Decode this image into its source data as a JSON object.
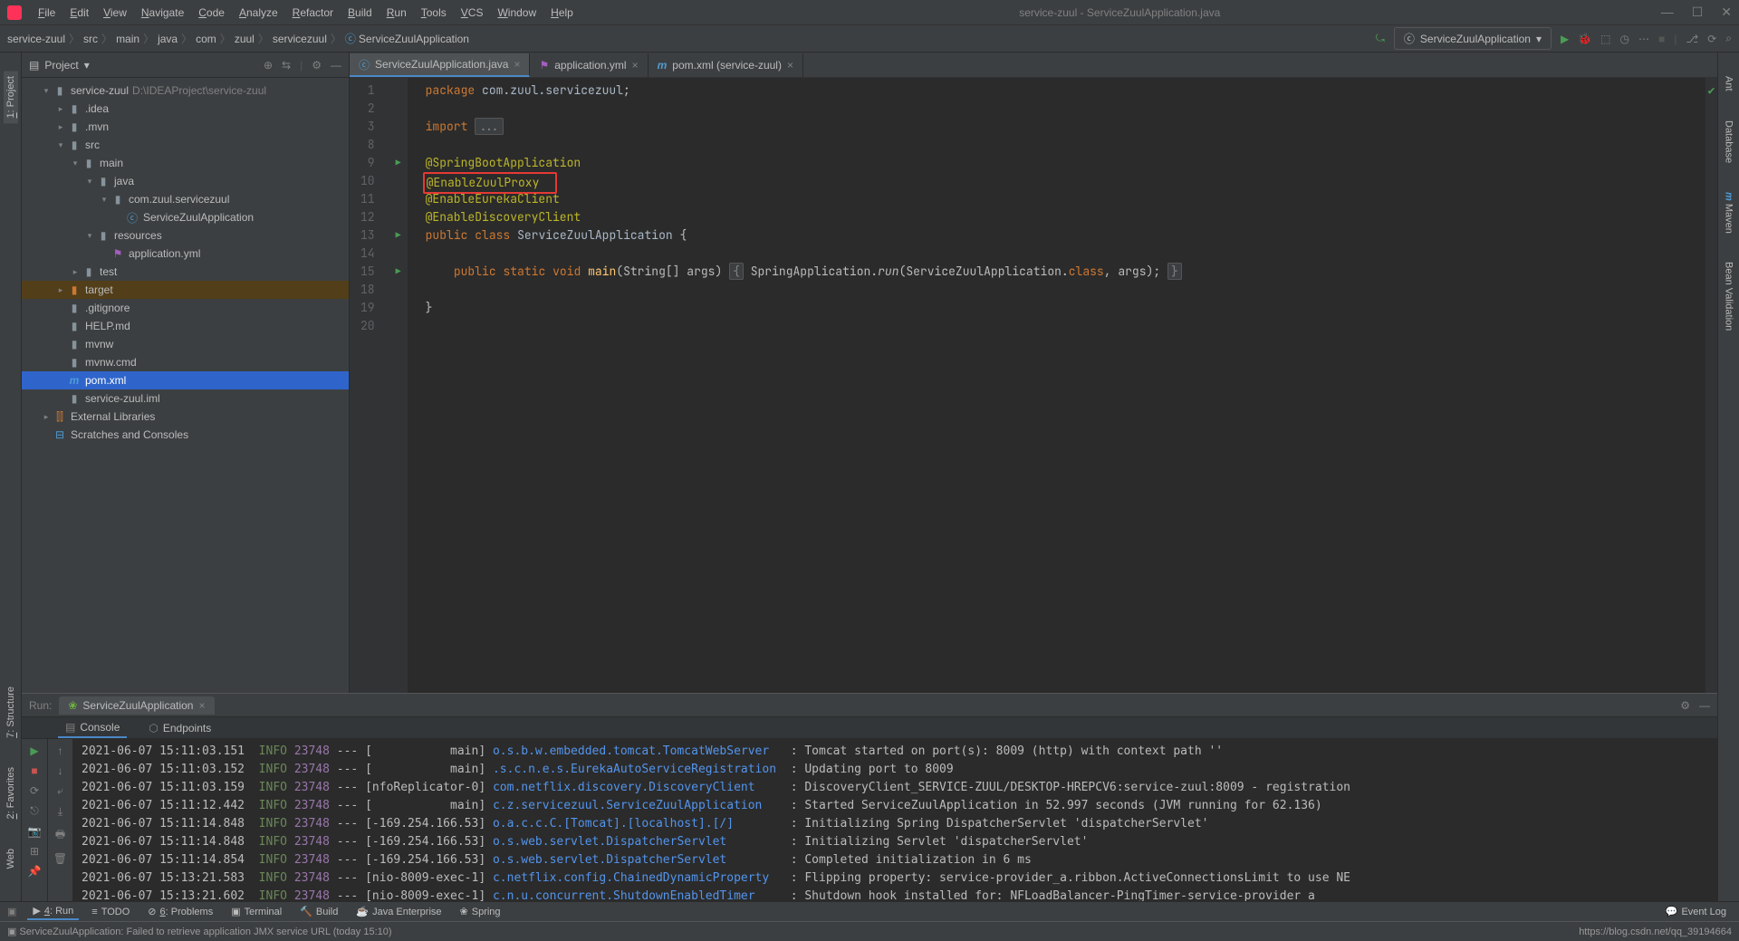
{
  "window": {
    "title": "service-zuul - ServiceZuulApplication.java"
  },
  "menu": [
    "File",
    "Edit",
    "View",
    "Navigate",
    "Code",
    "Analyze",
    "Refactor",
    "Build",
    "Run",
    "Tools",
    "VCS",
    "Window",
    "Help"
  ],
  "breadcrumb": [
    "service-zuul",
    "src",
    "main",
    "java",
    "com",
    "zuul",
    "servicezuul",
    "ServiceZuulApplication"
  ],
  "run_config": "ServiceZuulApplication",
  "project_panel": {
    "title": "Project",
    "root": {
      "name": "service-zuul",
      "path": "D:\\IDEAProject\\service-zuul"
    },
    "tree": [
      {
        "depth": 1,
        "arrow": "▾",
        "icon": "folder",
        "label": "service-zuul",
        "path": "D:\\IDEAProject\\service-zuul"
      },
      {
        "depth": 2,
        "arrow": "▸",
        "icon": "folder",
        "label": ".idea"
      },
      {
        "depth": 2,
        "arrow": "▸",
        "icon": "folder",
        "label": ".mvn"
      },
      {
        "depth": 2,
        "arrow": "▾",
        "icon": "folder",
        "label": "src"
      },
      {
        "depth": 3,
        "arrow": "▾",
        "icon": "folder",
        "label": "main"
      },
      {
        "depth": 4,
        "arrow": "▾",
        "icon": "folder-src",
        "label": "java"
      },
      {
        "depth": 5,
        "arrow": "▾",
        "icon": "package",
        "label": "com.zuul.servicezuul"
      },
      {
        "depth": 6,
        "arrow": "",
        "icon": "class",
        "label": "ServiceZuulApplication"
      },
      {
        "depth": 4,
        "arrow": "▾",
        "icon": "folder-res",
        "label": "resources"
      },
      {
        "depth": 5,
        "arrow": "",
        "icon": "yml",
        "label": "application.yml"
      },
      {
        "depth": 3,
        "arrow": "▸",
        "icon": "folder",
        "label": "test"
      },
      {
        "depth": 2,
        "arrow": "▸",
        "icon": "folder-ex",
        "label": "target",
        "hl": true
      },
      {
        "depth": 2,
        "arrow": "",
        "icon": "file",
        "label": ".gitignore"
      },
      {
        "depth": 2,
        "arrow": "",
        "icon": "file",
        "label": "HELP.md"
      },
      {
        "depth": 2,
        "arrow": "",
        "icon": "file",
        "label": "mvnw"
      },
      {
        "depth": 2,
        "arrow": "",
        "icon": "file",
        "label": "mvnw.cmd"
      },
      {
        "depth": 2,
        "arrow": "",
        "icon": "maven",
        "label": "pom.xml",
        "selected": true
      },
      {
        "depth": 2,
        "arrow": "",
        "icon": "file",
        "label": "service-zuul.iml"
      },
      {
        "depth": 1,
        "arrow": "▸",
        "icon": "lib",
        "label": "External Libraries"
      },
      {
        "depth": 1,
        "arrow": "",
        "icon": "scratch",
        "label": "Scratches and Consoles"
      }
    ]
  },
  "editor_tabs": [
    {
      "icon": "class",
      "label": "ServiceZuulApplication.java",
      "active": true
    },
    {
      "icon": "yml",
      "label": "application.yml"
    },
    {
      "icon": "maven",
      "label": "pom.xml (service-zuul)"
    }
  ],
  "code": {
    "lines": [
      {
        "n": 1,
        "html": "<span class='kw'>package</span> <span class='pkg'>com.zuul.servicezuul</span>;"
      },
      {
        "n": 2,
        "html": ""
      },
      {
        "n": 3,
        "html": "<span class='kw'>import</span> <span class='fold'>...</span>"
      },
      {
        "n": 8,
        "html": ""
      },
      {
        "n": 9,
        "html": "<span class='anno'>@SpringBootApplication</span>",
        "gi": "▶"
      },
      {
        "n": 10,
        "html": "<span class='redbox'><span class='anno'>@EnableZuulProxy</span>&nbsp;&nbsp;</span>"
      },
      {
        "n": 11,
        "html": "<span class='anno'>@EnableEurekaClient</span>"
      },
      {
        "n": 12,
        "html": "<span class='anno'>@EnableDiscoveryClient</span>"
      },
      {
        "n": 13,
        "html": "<span class='kw'>public</span> <span class='kw'>class</span> <span class='cls'>ServiceZuulApplication</span> {",
        "gi": "▶▶"
      },
      {
        "n": 14,
        "html": ""
      },
      {
        "n": 15,
        "html": "    <span class='kw'>public</span> <span class='kw'>static</span> <span class='kw'>void</span> <span class='mth'>main</span>(String[] args) <span class='fold'>{</span> SpringApplication.<span style='font-style:italic'>run</span>(ServiceZuulApplication.<span class='kw'>class</span>, args); <span class='fold'>}</span>",
        "gi": "▶"
      },
      {
        "n": 18,
        "html": ""
      },
      {
        "n": 19,
        "html": "}"
      },
      {
        "n": 20,
        "html": ""
      }
    ]
  },
  "run": {
    "label": "Run:",
    "config": "ServiceZuulApplication",
    "subtabs": [
      {
        "label": "Console",
        "icon": "▤",
        "active": true
      },
      {
        "label": "Endpoints",
        "icon": "⬡"
      }
    ],
    "logs": [
      {
        "ts": "2021-06-07 15:11:03.151",
        "lvl": "INFO",
        "pid": "23748",
        "thr": "[           main]",
        "src": "o.s.b.w.embedded.tomcat.TomcatWebServer  ",
        "msg": ": Tomcat started on port(s): 8009 (http) with context path ''"
      },
      {
        "ts": "2021-06-07 15:11:03.152",
        "lvl": "INFO",
        "pid": "23748",
        "thr": "[           main]",
        "src": ".s.c.n.e.s.EurekaAutoServiceRegistration ",
        "msg": ": Updating port to 8009"
      },
      {
        "ts": "2021-06-07 15:11:03.159",
        "lvl": "INFO",
        "pid": "23748",
        "thr": "[nfoReplicator-0]",
        "src": "com.netflix.discovery.DiscoveryClient    ",
        "msg": ": DiscoveryClient_SERVICE-ZUUL/DESKTOP-HREPCV6:service-zuul:8009 - registration"
      },
      {
        "ts": "2021-06-07 15:11:12.442",
        "lvl": "INFO",
        "pid": "23748",
        "thr": "[           main]",
        "src": "c.z.servicezuul.ServiceZuulApplication   ",
        "msg": ": Started ServiceZuulApplication in 52.997 seconds (JVM running for 62.136)"
      },
      {
        "ts": "2021-06-07 15:11:14.848",
        "lvl": "INFO",
        "pid": "23748",
        "thr": "[-169.254.166.53]",
        "src": "o.a.c.c.C.[Tomcat].[localhost].[/]       ",
        "msg": ": Initializing Spring DispatcherServlet 'dispatcherServlet'"
      },
      {
        "ts": "2021-06-07 15:11:14.848",
        "lvl": "INFO",
        "pid": "23748",
        "thr": "[-169.254.166.53]",
        "src": "o.s.web.servlet.DispatcherServlet        ",
        "msg": ": Initializing Servlet 'dispatcherServlet'"
      },
      {
        "ts": "2021-06-07 15:11:14.854",
        "lvl": "INFO",
        "pid": "23748",
        "thr": "[-169.254.166.53]",
        "src": "o.s.web.servlet.DispatcherServlet        ",
        "msg": ": Completed initialization in 6 ms"
      },
      {
        "ts": "2021-06-07 15:13:21.583",
        "lvl": "INFO",
        "pid": "23748",
        "thr": "[nio-8009-exec-1]",
        "src": "c.netflix.config.ChainedDynamicProperty  ",
        "msg": ": Flipping property: service-provider_a.ribbon.ActiveConnectionsLimit to use NE"
      },
      {
        "ts": "2021-06-07 15:13:21.602",
        "lvl": "INFO",
        "pid": "23748",
        "thr": "[nio-8009-exec-1]",
        "src": "c.n.u.concurrent.ShutdownEnabledTimer    ",
        "msg": ": Shutdown hook installed for: NFLoadBalancer-PingTimer-service-provider_a"
      }
    ]
  },
  "bottom_tabs": [
    {
      "icon": "▶",
      "label": "4: Run",
      "u": "4"
    },
    {
      "icon": "≡",
      "label": "TODO"
    },
    {
      "icon": "⊘",
      "label": "6: Problems",
      "u": "6"
    },
    {
      "icon": "▣",
      "label": "Terminal"
    },
    {
      "icon": "🔨",
      "label": "Build"
    },
    {
      "icon": "☕",
      "label": "Java Enterprise"
    },
    {
      "icon": "❀",
      "label": "Spring"
    }
  ],
  "bottom_right": "Event Log",
  "status": {
    "left": "ServiceZuulApplication: Failed to retrieve application JMX service URL (today 15:10)",
    "right": "https://blog.csdn.net/qq_39194664"
  },
  "left_tabs": [
    "1: Project"
  ],
  "right_tabs": [
    "Ant",
    "Database",
    "Maven",
    "Bean Validation"
  ],
  "left_tabs2": [
    "7: Structure",
    "2: Favorites",
    "Web"
  ]
}
